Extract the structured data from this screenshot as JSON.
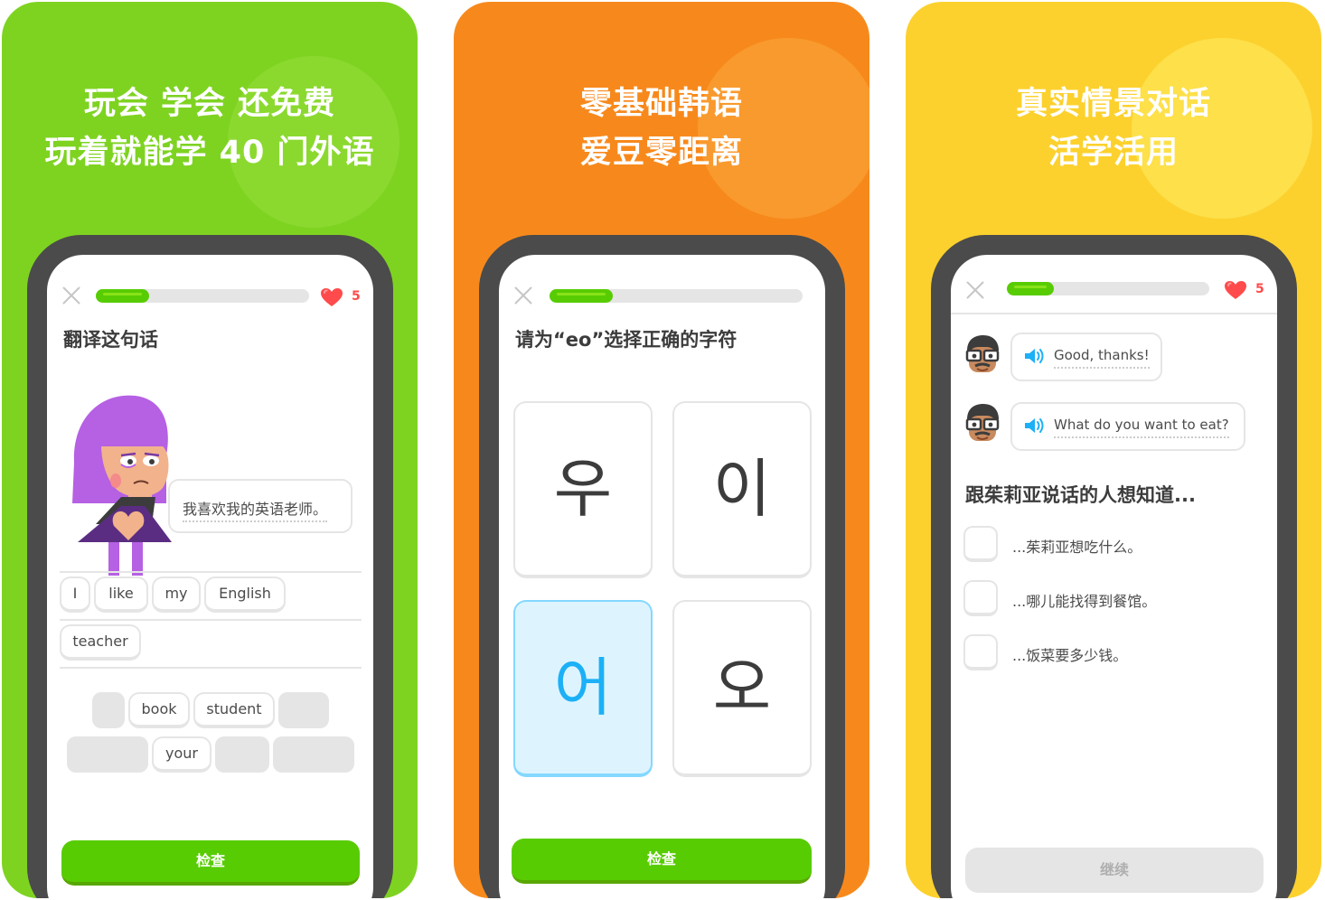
{
  "colors": {
    "panel1": "#7ed321",
    "panel2": "#f7891c",
    "panel3": "#fcd12d",
    "accent_green": "#58cc02",
    "heart_red": "#ff4b4b",
    "selected_blue": "#1cb0f6"
  },
  "panel1": {
    "headline_line1": "玩会 学会 还免费",
    "headline_line2": "玩着就能学 40 门外语",
    "progress": 0.25,
    "hearts": "5",
    "prompt": "翻译这句话",
    "speech": "我喜欢我的英语老师。",
    "answer_words": [
      "I",
      "like",
      "my",
      "English",
      "teacher"
    ],
    "bank_words": [
      "book",
      "student",
      "your"
    ],
    "check_button": "检查"
  },
  "panel2": {
    "headline_line1": "零基础韩语",
    "headline_line2": "爱豆零距离",
    "progress": 0.25,
    "prompt": "请为“eo”选择正确的字符",
    "choices": [
      "우",
      "이",
      "어",
      "오"
    ],
    "selected_choice": "어",
    "check_button": "检查"
  },
  "panel3": {
    "headline_line1": "真实情景对话",
    "headline_line2": "活学活用",
    "progress": 0.23,
    "hearts": "5",
    "chat1": "Good, thanks!",
    "chat2": "What do you want to eat?",
    "question": "跟茱莉亚说话的人想知道...",
    "options": [
      "...茱莉亚想吃什么。",
      "...哪儿能找得到餐馆。",
      "...饭菜要多少钱。"
    ],
    "continue_button": "继续"
  }
}
